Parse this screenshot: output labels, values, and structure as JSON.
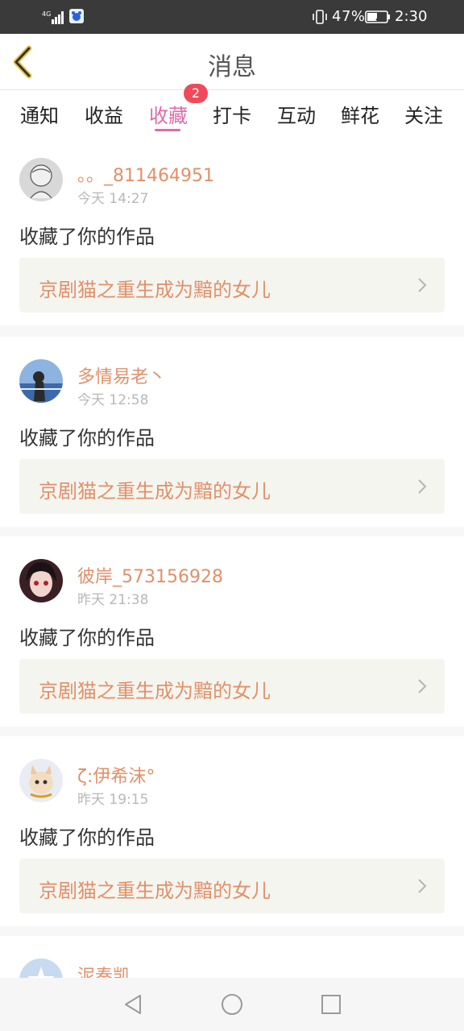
{
  "status_bar": {
    "network": "4G",
    "battery": "47%",
    "time": "2:30"
  },
  "header": {
    "title": "消息"
  },
  "tabs": [
    {
      "label": "通知"
    },
    {
      "label": "收益"
    },
    {
      "label": "收藏",
      "active": true,
      "badge": "2"
    },
    {
      "label": "打卡"
    },
    {
      "label": "互动"
    },
    {
      "label": "鲜花"
    },
    {
      "label": "关注"
    }
  ],
  "colors": {
    "accent": "#e06aa8",
    "username": "#e0906a",
    "badge": "#f04a5a"
  },
  "messages": [
    {
      "username": "。。_811464951",
      "time": "今天 14:27",
      "action": "收藏了你的作品",
      "work": "京剧猫之重生成为黯的女儿",
      "avatar": "sketch-avatar"
    },
    {
      "username": "多情易老丶",
      "time": "今天 12:58",
      "action": "收藏了你的作品",
      "work": "京剧猫之重生成为黯的女儿",
      "avatar": "girl-seaside-avatar"
    },
    {
      "username": "彼岸_573156928",
      "time": "昨天 21:38",
      "action": "收藏了你的作品",
      "work": "京剧猫之重生成为黯的女儿",
      "avatar": "anime-girl-avatar"
    },
    {
      "username": "ζ:伊希沫°",
      "time": "昨天 19:15",
      "action": "收藏了你的作品",
      "work": "京剧猫之重生成为黯的女儿",
      "avatar": "kitten-avatar"
    },
    {
      "username": "泥奏凯",
      "time": "",
      "action": "",
      "work": "",
      "avatar": "star-avatar"
    }
  ]
}
